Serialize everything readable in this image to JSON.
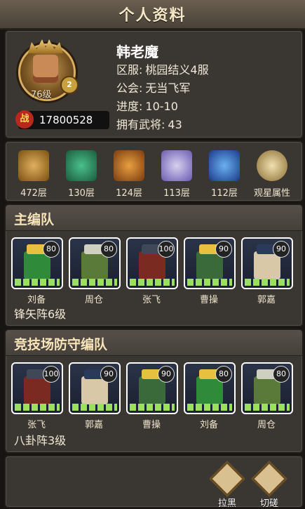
{
  "header": {
    "title": "个人资料"
  },
  "profile": {
    "level": "76级",
    "vip_badge": "2",
    "power_icon": "战",
    "power": "17800528",
    "name": "韩老魔",
    "server_label": "区服:",
    "server": "桃园结义4服",
    "guild_label": "公会:",
    "guild": "无当飞军",
    "progress_label": "进度:",
    "progress": "10-10",
    "generals_label": "拥有武将:",
    "generals": "43"
  },
  "stars": [
    {
      "label": "472层",
      "color": "#c8902c",
      "icon": "crossed-swords-icon"
    },
    {
      "label": "130层",
      "color": "#2c9a6c",
      "icon": "green-dragon-icon"
    },
    {
      "label": "124层",
      "color": "#c8781c",
      "icon": "gold-dragon-icon"
    },
    {
      "label": "113层",
      "color": "#a49ad8",
      "icon": "purple-beast-icon"
    },
    {
      "label": "112层",
      "color": "#2c5ac8",
      "icon": "blue-crystal-icon"
    },
    {
      "label": "观星属性",
      "color": "#d0b070",
      "icon": "yin-yang-icon"
    }
  ],
  "main_team": {
    "title": "主编队",
    "formation": "锋矢阵6级",
    "heroes": [
      {
        "name": "刘备",
        "level": "80",
        "color": "#2f8a3a",
        "hat": "#e8c040"
      },
      {
        "name": "周仓",
        "level": "80",
        "color": "#5a7a3a",
        "hat": "#d0d0c0"
      },
      {
        "name": "张飞",
        "level": "100",
        "color": "#7a2a20",
        "hat": "#404858"
      },
      {
        "name": "曹操",
        "level": "90",
        "color": "#3a6a3a",
        "hat": "#e8c040"
      },
      {
        "name": "郭嘉",
        "level": "90",
        "color": "#d8c8a8",
        "hat": "#2a3a5a"
      }
    ]
  },
  "arena_team": {
    "title": "竞技场防守编队",
    "formation": "八卦阵3级",
    "heroes": [
      {
        "name": "张飞",
        "level": "100",
        "color": "#7a2a20",
        "hat": "#404858"
      },
      {
        "name": "郭嘉",
        "level": "90",
        "color": "#d8c8a8",
        "hat": "#2a3a5a"
      },
      {
        "name": "曹操",
        "level": "90",
        "color": "#3a6a3a",
        "hat": "#e8c040"
      },
      {
        "name": "刘备",
        "level": "80",
        "color": "#2f8a3a",
        "hat": "#e8c040"
      },
      {
        "name": "周仓",
        "level": "80",
        "color": "#5a7a3a",
        "hat": "#d0d0c0"
      }
    ]
  },
  "actions": {
    "blacklist": "拉黑",
    "spar": "切磋"
  }
}
